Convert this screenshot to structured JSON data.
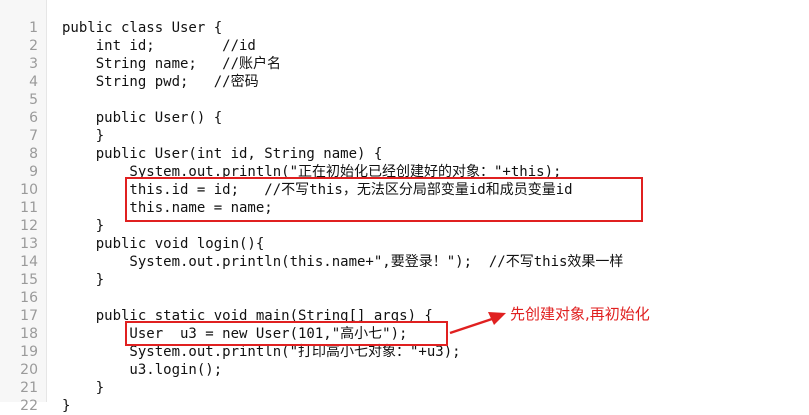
{
  "lines": [
    {
      "num": "1",
      "text": "public class User {"
    },
    {
      "num": "2",
      "text": "    int id;        //id"
    },
    {
      "num": "3",
      "text": "    String name;   //账户名"
    },
    {
      "num": "4",
      "text": "    String pwd;   //密码"
    },
    {
      "num": "5",
      "text": ""
    },
    {
      "num": "6",
      "text": "    public User() {"
    },
    {
      "num": "7",
      "text": "    }"
    },
    {
      "num": "8",
      "text": "    public User(int id, String name) {"
    },
    {
      "num": "9",
      "text": "        System.out.println(\"正在初始化已经创建好的对象：\"+this);"
    },
    {
      "num": "10",
      "text": "        this.id = id;   //不写this，无法区分局部变量id和成员变量id"
    },
    {
      "num": "11",
      "text": "        this.name = name;"
    },
    {
      "num": "12",
      "text": "    }"
    },
    {
      "num": "13",
      "text": "    public void login(){"
    },
    {
      "num": "14",
      "text": "        System.out.println(this.name+\",要登录！\");  //不写this效果一样"
    },
    {
      "num": "15",
      "text": "    }"
    },
    {
      "num": "16",
      "text": ""
    },
    {
      "num": "17",
      "text": "    public static void main(String[] args) {"
    },
    {
      "num": "18",
      "text": "        User  u3 = new User(101,\"高小七\");"
    },
    {
      "num": "19",
      "text": "        System.out.println(\"打印高小七对象：\"+u3);"
    },
    {
      "num": "20",
      "text": "        u3.login();"
    },
    {
      "num": "21",
      "text": "    }"
    },
    {
      "num": "22",
      "text": "}"
    }
  ],
  "gutter_numbers": [
    "1",
    "2",
    "3",
    "4",
    "5",
    "6",
    "7",
    "8",
    "9",
    "10",
    "11",
    "12",
    "13",
    "14",
    "15",
    "16",
    "17",
    "18",
    "19",
    "20",
    "21",
    "22"
  ],
  "annotation": "先创建对象,再初始化",
  "colors": {
    "highlight": "#e02020",
    "gutter_bg": "#f7f7f7",
    "gutter_text": "#9a9a9a"
  }
}
